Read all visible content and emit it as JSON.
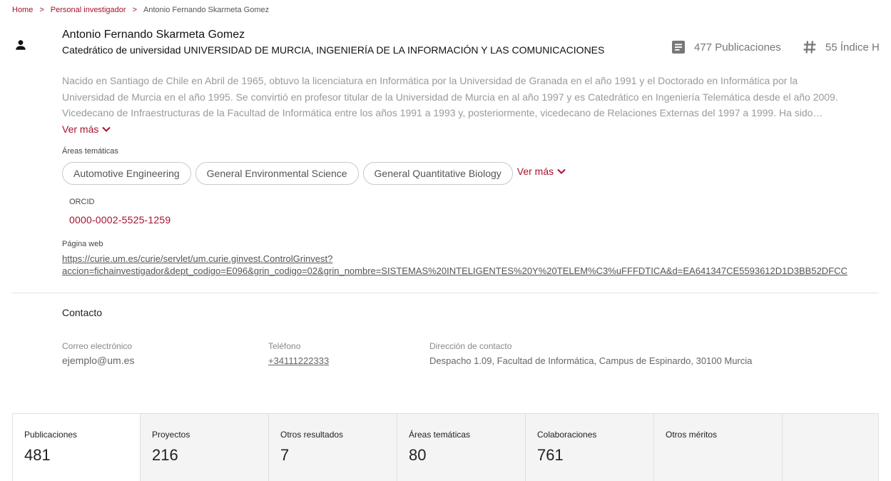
{
  "breadcrumb": {
    "home": "Home",
    "separator": ">",
    "section": "Personal investigador",
    "current": "Antonio Fernando Skarmeta Gomez"
  },
  "profile": {
    "icon": "person-icon",
    "name": "Antonio Fernando Skarmeta Gomez",
    "position": "Catedrático de universidad UNIVERSIDAD DE MURCIA, INGENIERÍA DE LA INFORMACIÓN Y LAS COMUNICACIONES",
    "metrics": {
      "publications_icon": "document-icon",
      "publications": "477 Publicaciones",
      "hindex_icon": "hashtag-icon",
      "hindex": "55 Índice H"
    },
    "bio_lines": [
      "Nacido en Santiago de Chile en Abril de 1965, obtuvo la licenciatura en Informática por la Universidad de Granada en el año 1991 y el Doctorado en Informática por la",
      "Universidad de Murcia en el año 1995. Se convirtió en profesor titular de la Universidad de Murcia en al año 1997 y es Catedrático en Ingeniería Telemática desde el año 2009.",
      "Vicedecano de Infraestructuras de la Facultad de Informática entre los años 1991 a 1993 y, posteriormente, vicedecano de Relaciones Externas del 1997 a 1999. Ha sido…"
    ],
    "bio_more": "Ver más",
    "areas_label": "Áreas temáticas",
    "areas": [
      "Automotive Engineering",
      "General Environmental Science",
      "General Quantitative Biology"
    ],
    "areas_more": "Ver más",
    "orcid_label": "ORCID",
    "orcid": "0000-0002-5525-1259",
    "web_label": "Página web",
    "web_line1": "https://curie.um.es/curie/servlet/um.curie.ginvest.ControlGrinvest?",
    "web_line2": "accion=fichainvestigador&dept_codigo=E096&grin_codigo=02&grin_nombre=SISTEMAS%20INTELIGENTES%20Y%20TELEM%C3%uFFFDTICA&d=EA641347CE5593612D1D3BB52DFCC"
  },
  "contact": {
    "title": "Contacto",
    "email_label": "Correo electrónico",
    "email": "ejemplo@um.es",
    "phone_label": "Teléfono",
    "phone": "+34111222333",
    "address_label": "Dirección de contacto",
    "address": "Despacho 1.09, Facultad de Informática, Campus de Espinardo, 30100 Murcia"
  },
  "tabs": [
    {
      "label": "Publicaciones",
      "count": "481"
    },
    {
      "label": "Proyectos",
      "count": "216"
    },
    {
      "label": "Otros resultados",
      "count": "7"
    },
    {
      "label": "Áreas temáticas",
      "count": "80"
    },
    {
      "label": "Colaboraciones",
      "count": "761"
    },
    {
      "label": "Otros méritos",
      "count": ""
    }
  ],
  "colors": {
    "accent": "#a5122e",
    "muted_text": "#9a9a9a",
    "tab_bg": "#f4f4f4"
  }
}
